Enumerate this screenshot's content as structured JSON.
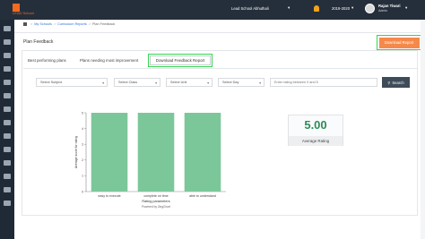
{
  "brand": {
    "name": "LEAD School",
    "accent": "#f26b21"
  },
  "topbar": {
    "school": "Lead School Abhuthali",
    "year": "2019-2020",
    "user_name": "Rajan Tiwari",
    "user_role": "Admin"
  },
  "sidebar": {
    "icons": [
      "home-icon",
      "users-icon",
      "book-icon",
      "clipboard-icon",
      "chart-icon",
      "calendar-icon",
      "grid-icon",
      "settings-icon",
      "list-icon",
      "refresh-icon",
      "document-icon",
      "people-icon",
      "sliders-icon",
      "power-icon"
    ]
  },
  "breadcrumb": {
    "items": [
      "My Schools",
      "Curriculum Reports",
      "Plan Feedback"
    ]
  },
  "page": {
    "title": "Plan Feedback",
    "download_label": "Download Report"
  },
  "tabs": [
    {
      "label": "Best performing plans",
      "active": false
    },
    {
      "label": "Plans needing most improvement",
      "active": false
    },
    {
      "label": "Download Feedback Report",
      "active": true
    }
  ],
  "filters": {
    "subject": "Select Subject",
    "class": "Select Class",
    "unit": "Select Unit",
    "day": "Select Day",
    "rating_placeholder": "Enter rating between 0 and 5",
    "search_label": "Search"
  },
  "chart_data": {
    "type": "bar",
    "categories": [
      "easy to execute",
      "complete on time",
      "able to understand"
    ],
    "values": [
      5,
      5,
      5
    ],
    "xlabel": "Rating parameters",
    "ylabel": "Average score for rating",
    "ylim": [
      0,
      5
    ],
    "yticks": [
      0,
      1,
      2,
      3,
      4,
      5
    ],
    "color": "#7cc79a",
    "grid": false,
    "credit": "Powered by ZingChart"
  },
  "rating": {
    "value": "5.00",
    "label": "Average Rating",
    "color": "#2e8b57"
  }
}
